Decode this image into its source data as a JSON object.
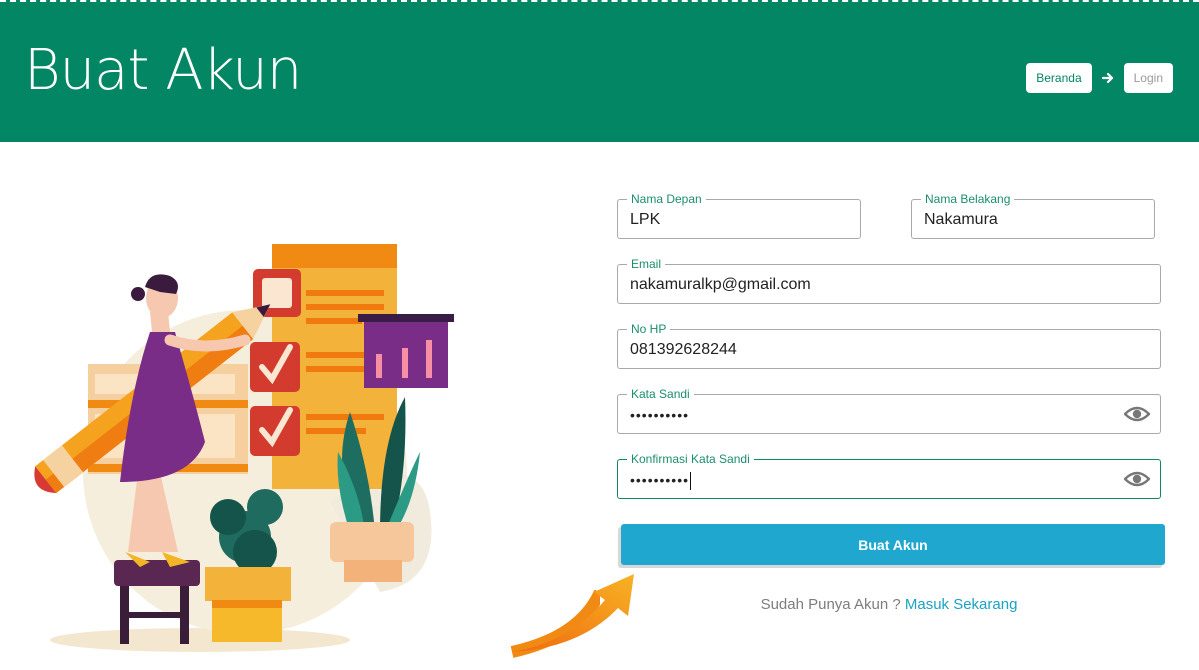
{
  "header": {
    "title": "Buat Akun",
    "breadcrumb": {
      "home": "Beranda",
      "current": "Login"
    }
  },
  "form": {
    "first_name": {
      "label": "Nama Depan",
      "value": "LPK"
    },
    "last_name": {
      "label": "Nama Belakang",
      "value": "Nakamura"
    },
    "email": {
      "label": "Email",
      "value": "nakamuralkp@gmail.com"
    },
    "phone": {
      "label": "No HP",
      "value": "081392628244"
    },
    "password": {
      "label": "Kata Sandi",
      "value": "••••••••••"
    },
    "confirm_password": {
      "label": "Konfirmasi Kata Sandi",
      "value": "••••••••••"
    },
    "submit_label": "Buat Akun",
    "login_prompt": "Sudah Punya Akun ? ",
    "login_link": "Masuk Sekarang"
  },
  "icons": {
    "breadcrumb_separator": "arrow-right-icon",
    "password_toggle": "eye-icon"
  },
  "colors": {
    "header_bg": "#038663",
    "accent_green": "#1a8f6c",
    "button_blue": "#1fa7d0",
    "link_blue": "#1aa3c2"
  }
}
